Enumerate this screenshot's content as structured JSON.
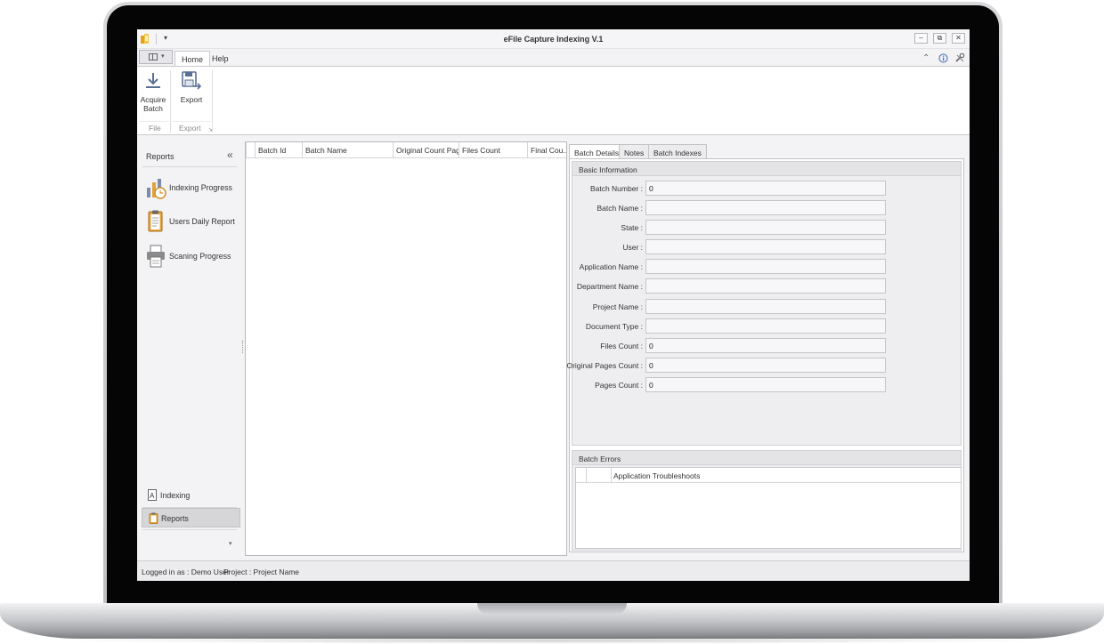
{
  "window": {
    "title": "eFile Capture Indexing V.1",
    "quick_access_dropdown": "▾",
    "controls": {
      "minimize": "‒",
      "restore": "⧉",
      "close": "✕"
    }
  },
  "ribbon": {
    "tabs": [
      {
        "label": "Home",
        "active": true
      },
      {
        "label": "Help",
        "active": false
      }
    ],
    "right_icons": [
      "collapse-ribbon-icon",
      "info-icon",
      "tools-icon"
    ],
    "groups": [
      {
        "label": "File",
        "buttons": [
          {
            "label": "Acquire Batch",
            "icon": "download-arrow-icon"
          }
        ]
      },
      {
        "label": "Export",
        "buttons": [
          {
            "label": "Export",
            "icon": "floppy-export-icon"
          }
        ]
      }
    ]
  },
  "nav": {
    "title": "Reports",
    "collapse_glyph": "«",
    "items": [
      {
        "label": "Indexing Progress",
        "icon": "bar-chart-clock-icon"
      },
      {
        "label": "Users Daily Report",
        "icon": "clipboard-icon"
      },
      {
        "label": "Scaning Progress",
        "icon": "printer-icon"
      }
    ],
    "bottom_items": [
      {
        "label": "Indexing",
        "icon": "indexing-a-icon",
        "active": false
      },
      {
        "label": "Reports",
        "icon": "report-clipboard-icon",
        "active": true
      }
    ],
    "more_glyph": "▾"
  },
  "grid": {
    "columns": [
      "Batch Id",
      "Batch Name",
      "Original Count Pages",
      "Files Count",
      "Final Cou..."
    ],
    "rows": []
  },
  "details": {
    "tabs": [
      {
        "label": "Batch Details",
        "active": true
      },
      {
        "label": "Notes",
        "active": false
      },
      {
        "label": "Batch Indexes",
        "active": false
      }
    ],
    "basic_info": {
      "caption": "Basic Information",
      "fields": [
        {
          "label": "Batch Number :",
          "value": "0"
        },
        {
          "label": "Batch Name :",
          "value": ""
        },
        {
          "label": "State :",
          "value": ""
        },
        {
          "label": "User :",
          "value": ""
        },
        {
          "label": "Application Name :",
          "value": ""
        },
        {
          "label": "Department Name :",
          "value": ""
        },
        {
          "label": "Project Name :",
          "value": ""
        },
        {
          "label": "Document Type :",
          "value": ""
        },
        {
          "label": "Files Count :",
          "value": "0"
        },
        {
          "label": "Original Pages Count :",
          "value": "0"
        },
        {
          "label": "Pages Count :",
          "value": "0"
        }
      ]
    },
    "batch_errors": {
      "caption": "Batch Errors",
      "columns": [
        "",
        "",
        "Application Troubleshoots"
      ],
      "rows": []
    }
  },
  "status": {
    "logged_in": "Logged in as : Demo User",
    "project": "Project : Project Name"
  }
}
